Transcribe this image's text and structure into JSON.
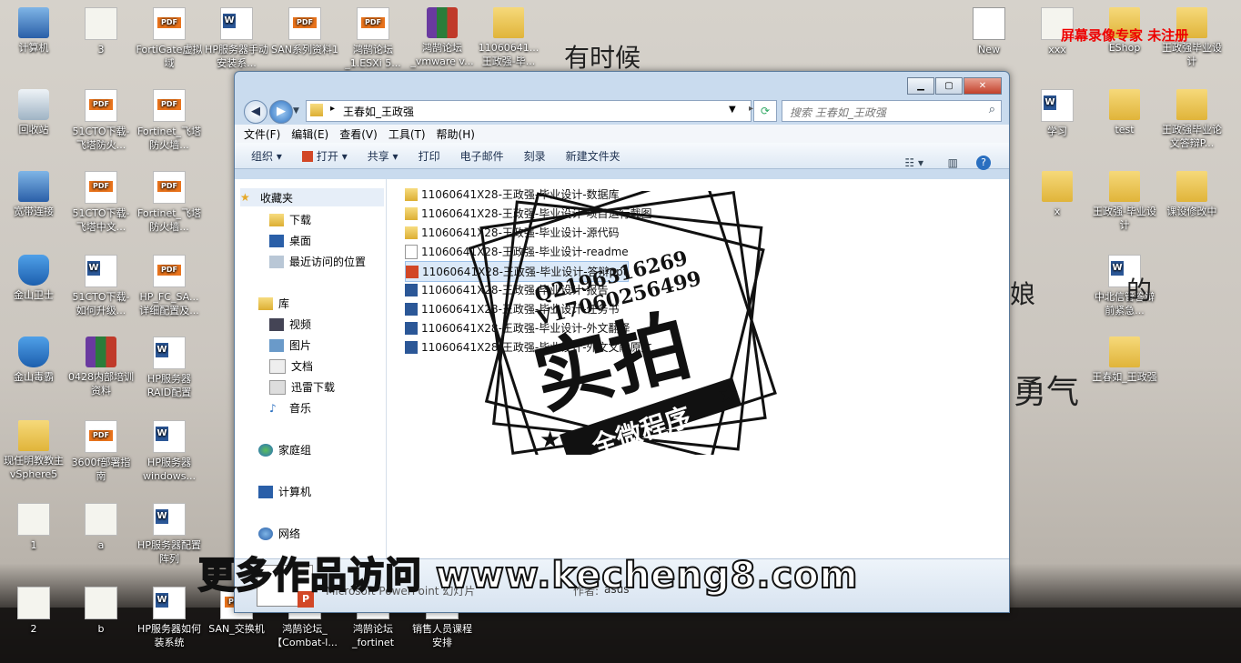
{
  "desktop": {
    "icons_left": [
      {
        "label": "计算机",
        "icon": "computer-icon"
      },
      {
        "label": "3",
        "icon": "text-file-icon"
      },
      {
        "label": "FortiGate虚拟域",
        "icon": "pdf-icon"
      },
      {
        "label": "HP服务器手动安装系...",
        "icon": "word-icon"
      },
      {
        "label": "SAN系列资料1",
        "icon": "pdf-icon"
      },
      {
        "label": "鸿鹄论坛_1.ESXi 5...",
        "icon": "pdf-icon"
      },
      {
        "label": "鸿鹄论坛_vmware v...",
        "icon": "rar-icon"
      },
      {
        "label": "11060641...王政强-毕...",
        "icon": "folder-icon"
      },
      {
        "label": "回收站",
        "icon": "recycle-bin-icon"
      },
      {
        "label": "51CTO下载-飞塔防火...",
        "icon": "pdf-icon"
      },
      {
        "label": "Fortinet_飞塔防火墙...",
        "icon": "pdf-icon"
      },
      {
        "label": "宽带连接",
        "icon": "network-icon"
      },
      {
        "label": "51CTO下载-飞塔中文...",
        "icon": "pdf-icon"
      },
      {
        "label": "Fortinet_飞塔防火墙...",
        "icon": "pdf-icon"
      },
      {
        "label": "金山卫士",
        "icon": "shield-icon"
      },
      {
        "label": "51CTO下载-如何升级...",
        "icon": "word-icon"
      },
      {
        "label": "HP_FC_SA...详细配置及...",
        "icon": "pdf-icon"
      },
      {
        "label": "金山毒霸",
        "icon": "antivirus-icon"
      },
      {
        "label": "0428内部培训资料",
        "icon": "rar-icon"
      },
      {
        "label": "HP服务器RAID配置",
        "icon": "word-icon"
      },
      {
        "label": "现任明教教主 vSphere5",
        "icon": "folder-icon"
      },
      {
        "label": "3600f部署指南",
        "icon": "pdf-icon"
      },
      {
        "label": "HP服务器windows...",
        "icon": "word-icon"
      },
      {
        "label": "1",
        "icon": "text-file-icon"
      },
      {
        "label": "a",
        "icon": "text-file-icon"
      },
      {
        "label": "HP服务器配置阵列",
        "icon": "word-icon"
      },
      {
        "label": "2",
        "icon": "text-file-icon"
      },
      {
        "label": "b",
        "icon": "text-file-icon"
      },
      {
        "label": "HP服务器如何装系统",
        "icon": "word-icon"
      },
      {
        "label": "SAN_交换机",
        "icon": "pdf-icon"
      },
      {
        "label": "鸿鹄论坛_【Combat-l...",
        "icon": "pdf-icon"
      },
      {
        "label": "鸿鹄论坛_fortinet",
        "icon": "pdf-icon"
      },
      {
        "label": "销售人员课程安排",
        "icon": "word-icon"
      }
    ],
    "icons_right": [
      {
        "label": "New",
        "icon": "new-icon"
      },
      {
        "label": "xxx",
        "icon": "text-file-icon"
      },
      {
        "label": "EShop",
        "icon": "folder-icon"
      },
      {
        "label": "王政强毕业设计",
        "icon": "folder-icon"
      },
      {
        "label": "学习",
        "icon": "word-icon"
      },
      {
        "label": "test",
        "icon": "folder-icon"
      },
      {
        "label": "王政强毕业论文答辩P...",
        "icon": "folder-icon"
      },
      {
        "label": "x",
        "icon": "folder-icon"
      },
      {
        "label": "王政强-毕业设计",
        "icon": "folder-icon"
      },
      {
        "label": "课设修改中",
        "icon": "folder-icon"
      },
      {
        "label": "中北信管答辩前紧急...",
        "icon": "word-icon"
      },
      {
        "label": "王春如_王政强",
        "icon": "folder-icon"
      }
    ],
    "overlay_text": [
      "有时候",
      "娘",
      "的",
      "勇气"
    ],
    "red_watermark": "屏幕录像专家 未注册"
  },
  "explorer": {
    "path": "王春如_王政强",
    "search_placeholder": "搜索 王春如_王政强",
    "menu": [
      "文件(F)",
      "编辑(E)",
      "查看(V)",
      "工具(T)",
      "帮助(H)"
    ],
    "toolbar": [
      "组织",
      "打开",
      "共享",
      "打印",
      "电子邮件",
      "刻录",
      "新建文件夹"
    ],
    "nav": {
      "favorites": "收藏夹",
      "favorites_items": [
        "下载",
        "桌面",
        "最近访问的位置"
      ],
      "libraries": "库",
      "libraries_items": [
        "视频",
        "图片",
        "文档",
        "迅雷下载",
        "音乐"
      ],
      "homegroup": "家庭组",
      "computer": "计算机",
      "network": "网络"
    },
    "files": [
      {
        "name": "11060641X28-王政强-毕业设计-数据库",
        "type": "folder"
      },
      {
        "name": "11060641X28-王政强-毕业设计-项目运行截图",
        "type": "folder"
      },
      {
        "name": "11060641X28-王政强-毕业设计-源代码",
        "type": "folder"
      },
      {
        "name": "11060641X28-王政强-毕业设计-readme",
        "type": "txt"
      },
      {
        "name": "11060641X28-王政强-毕业设计-答辩ppt",
        "type": "ppt",
        "selected": true
      },
      {
        "name": "11060641X28-王政强-毕业设计-报告",
        "type": "doc"
      },
      {
        "name": "11060641X28-王政强-毕业设计-任务书",
        "type": "doc"
      },
      {
        "name": "11060641X28-王政强-毕业设计-外文翻译",
        "type": "doc"
      },
      {
        "name": "11060641X28-王政强-毕业设计-外文文献原文",
        "type": "doc"
      }
    ],
    "details": {
      "filetype": "Microsoft PowerPoint 幻灯片",
      "author_label": "作者:",
      "author": "asus"
    }
  },
  "stamp": {
    "qq": "Q2196316269",
    "v": "V17060256499",
    "main": "实拍",
    "sub": "全微程序"
  },
  "bottom_watermark": "更多作品访问 www.kecheng8.com"
}
